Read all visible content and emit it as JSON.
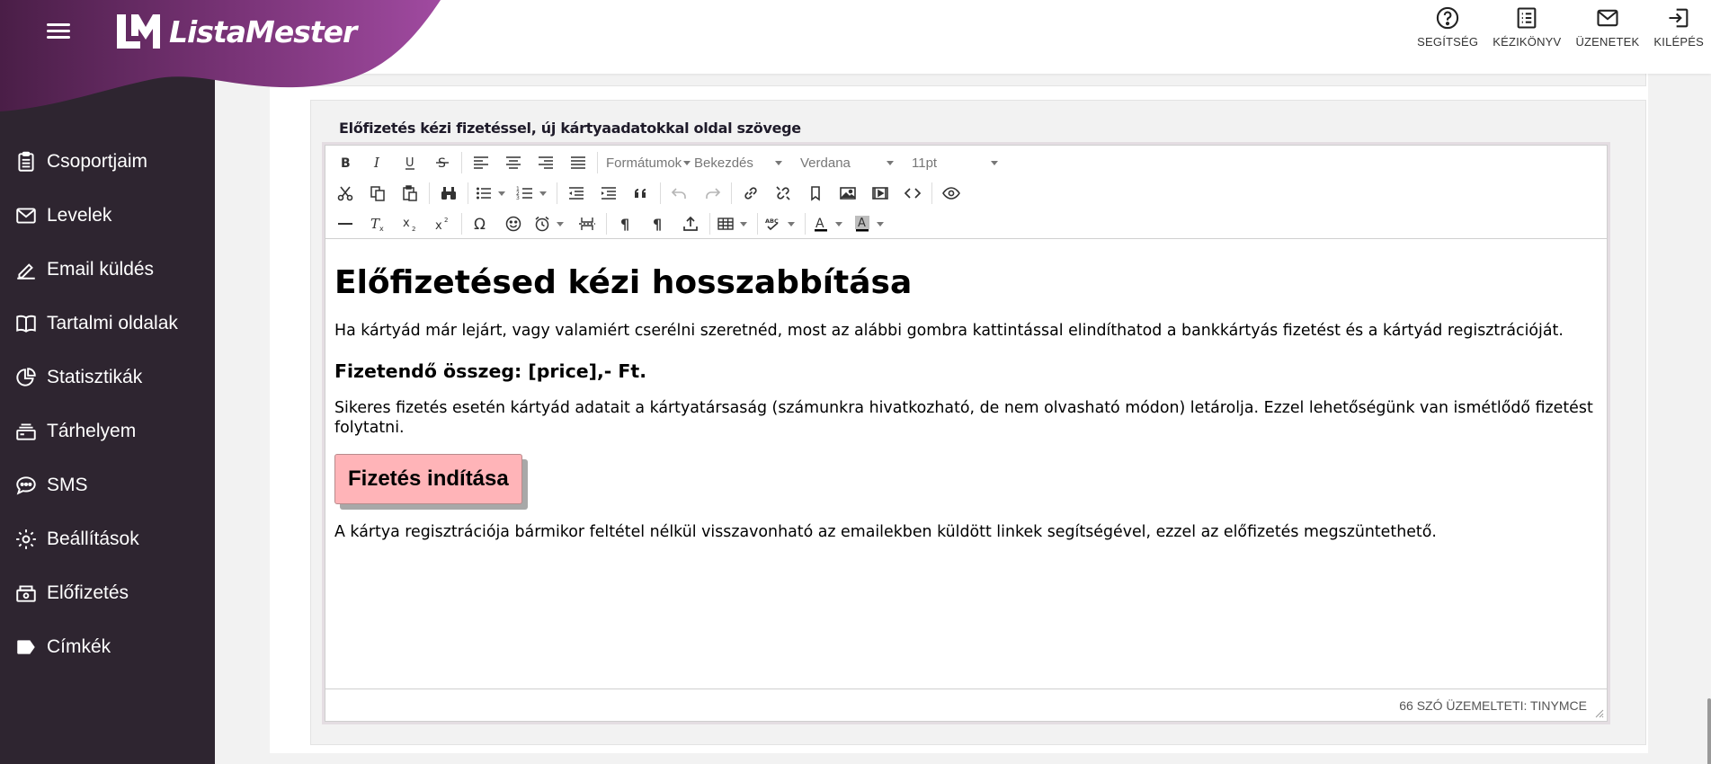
{
  "brand": {
    "name": "ListaMester",
    "logo_mark": "LM",
    "brand_color": "#8a3d8e",
    "sidebar_color": "#2e2530"
  },
  "sidebar": {
    "items": [
      {
        "label": "Csoportjaim",
        "icon": "clipboard-icon"
      },
      {
        "label": "Levelek",
        "icon": "envelope-icon"
      },
      {
        "label": "Email küldés",
        "icon": "pencil-icon"
      },
      {
        "label": "Tartalmi oldalak",
        "icon": "book-icon"
      },
      {
        "label": "Statisztikák",
        "icon": "pie-chart-icon"
      },
      {
        "label": "Tárhelyem",
        "icon": "storage-icon"
      },
      {
        "label": "SMS",
        "icon": "chat-bubble-icon"
      },
      {
        "label": "Beállítások",
        "icon": "gear-icon"
      },
      {
        "label": "Előfizetés",
        "icon": "cash-register-icon"
      },
      {
        "label": "Címkék",
        "icon": "tag-icon"
      }
    ]
  },
  "topbar": {
    "actions": [
      {
        "label": "SEGÍTSÉG",
        "icon": "help-circle-icon"
      },
      {
        "label": "KÉZIKÖNYV",
        "icon": "manual-list-icon"
      },
      {
        "label": "ÜZENETEK",
        "icon": "mail-icon"
      },
      {
        "label": "KILÉPÉS",
        "icon": "logout-icon"
      }
    ]
  },
  "card": {
    "title": "Előfizetés kézi fizetéssel, új kártyaadatokkal oldal szövege"
  },
  "editor": {
    "toolbar": {
      "formats_label": "Formátumok",
      "block_label": "Bekezdés",
      "font_family": "Verdana",
      "font_size": "11pt"
    },
    "content": {
      "heading": "Előfizetésed kézi hosszabbítása",
      "intro": "Ha kártyád már lejárt, vagy valamiért cserélni szeretnéd, most az alábbi gombra kattintással elindíthatod a bankkártyás fizetést és a kártyád regisztrációját.",
      "amount": "Fizetendő összeg: [price],- Ft.",
      "info": "Sikeres fizetés esetén kártyád adatait a kártyatársaság (számunkra hivatkozható, de nem olvasható módon) letárolja. Ezzel lehetőségünk van ismétlődő fizetést folytatni.",
      "button_label": "Fizetés indítása",
      "button_color": "#ffb4b8",
      "footer_note": "A kártya regisztrációja bármikor feltétel nélkül visszavonható az emailekben küldött linkek segítségével, ezzel az előfizetés megszüntethető."
    },
    "statusbar": {
      "text": "66 SZÓ ÜZEMELTETI: TINYMCE"
    }
  }
}
